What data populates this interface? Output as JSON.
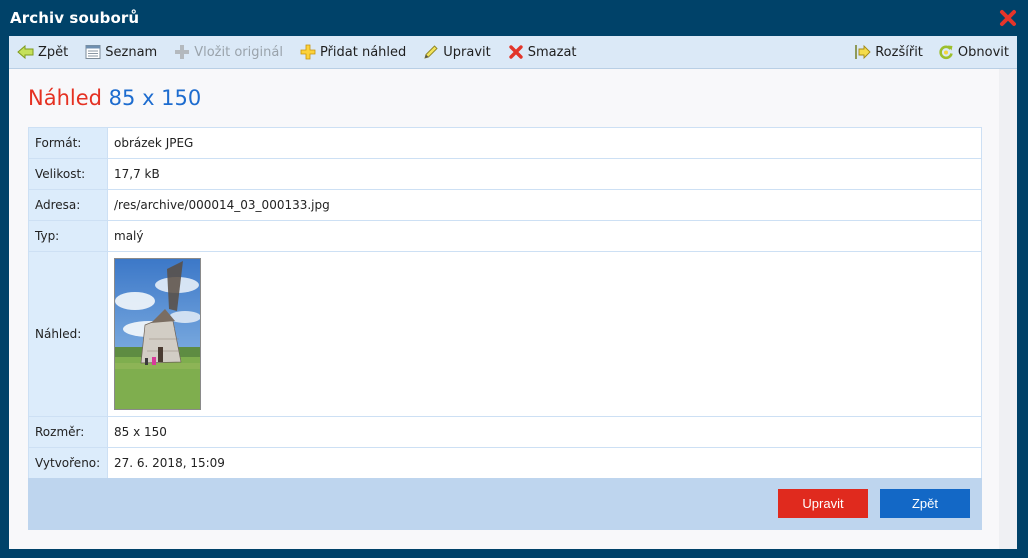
{
  "window": {
    "title": "Archiv souborů"
  },
  "toolbar": {
    "left": [
      {
        "label": "Zpět",
        "icon": "arrow-left-icon",
        "enabled": true
      },
      {
        "label": "Seznam",
        "icon": "list-icon",
        "enabled": true
      },
      {
        "label": "Vložit originál",
        "icon": "plus-gray-icon",
        "enabled": false
      },
      {
        "label": "Přidat náhled",
        "icon": "plus-yellow-icon",
        "enabled": true
      },
      {
        "label": "Upravit",
        "icon": "pencil-icon",
        "enabled": true
      },
      {
        "label": "Smazat",
        "icon": "delete-x-icon",
        "enabled": true
      }
    ],
    "right": [
      {
        "label": "Rozšířit",
        "icon": "expand-icon",
        "enabled": true
      },
      {
        "label": "Obnovit",
        "icon": "refresh-icon",
        "enabled": true
      }
    ]
  },
  "heading": {
    "label": "Náhled",
    "value": "85 x 150"
  },
  "details": {
    "format_label": "Formát:",
    "format_value": "obrázek JPEG",
    "size_label": "Velikost:",
    "size_value": "17,7 kB",
    "address_label": "Adresa:",
    "address_value": "/res/archive/000014_03_000133.jpg",
    "type_label": "Typ:",
    "type_value": "malý",
    "preview_label": "Náhled:",
    "dimension_label": "Rozměr:",
    "dimension_value": "85 x 150",
    "created_label": "Vytvořeno:",
    "created_value": "27. 6. 2018, 15:09"
  },
  "buttons": {
    "edit": "Upravit",
    "back": "Zpět"
  },
  "colors": {
    "titlebar": "#004269",
    "heading_label": "#e53122",
    "heading_value": "#1d6ccf",
    "edit_button": "#e02a1e",
    "back_button": "#1368c6"
  }
}
